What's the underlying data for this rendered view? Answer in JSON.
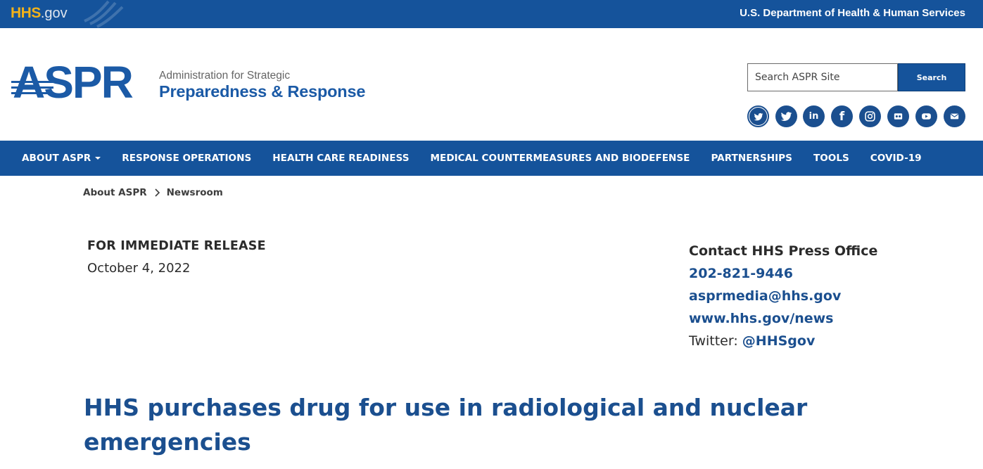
{
  "topbar": {
    "hhs_logo_main": "HHS",
    "hhs_logo_suffix": ".gov",
    "department": "U.S. Department of Health & Human Services"
  },
  "header": {
    "logo_acronym": "ASPR",
    "logo_line1": "Administration for Strategic",
    "logo_line2": "Preparedness & Response"
  },
  "search": {
    "placeholder": "Search ASPR Site",
    "value": "",
    "button_label": "Search"
  },
  "social": {
    "icons": [
      "twitter-bird-icon",
      "twitter-icon",
      "linkedin-icon",
      "facebook-icon",
      "instagram-icon",
      "flickr-icon",
      "youtube-icon",
      "email-icon"
    ],
    "linkedin_text": "in",
    "facebook_text": "f"
  },
  "nav": {
    "items": [
      {
        "label": "ABOUT ASPR"
      },
      {
        "label": "RESPONSE OPERATIONS"
      },
      {
        "label": "HEALTH CARE READINESS"
      },
      {
        "label": "MEDICAL COUNTERMEASURES AND BIODEFENSE"
      },
      {
        "label": "PARTNERSHIPS"
      },
      {
        "label": "TOOLS"
      },
      {
        "label": "COVID-19"
      }
    ]
  },
  "breadcrumb": {
    "items": [
      {
        "label": "About ASPR"
      },
      {
        "label": "Newsroom"
      }
    ]
  },
  "release": {
    "label": "FOR IMMEDIATE RELEASE",
    "date": "October 4, 2022"
  },
  "contact": {
    "title": "Contact HHS Press Office",
    "phone": "202-821-9446",
    "email": "asprmedia@hhs.gov",
    "website": "www.hhs.gov/news",
    "twitter_label": "Twitter: ",
    "twitter_handle": "@HHSgov"
  },
  "article": {
    "headline": "HHS purchases drug for use in radiological and nuclear emergencies"
  },
  "colors": {
    "brand_blue": "#15539b",
    "hhs_gold": "#f2b21a",
    "link_blue": "#1b4f8f"
  }
}
